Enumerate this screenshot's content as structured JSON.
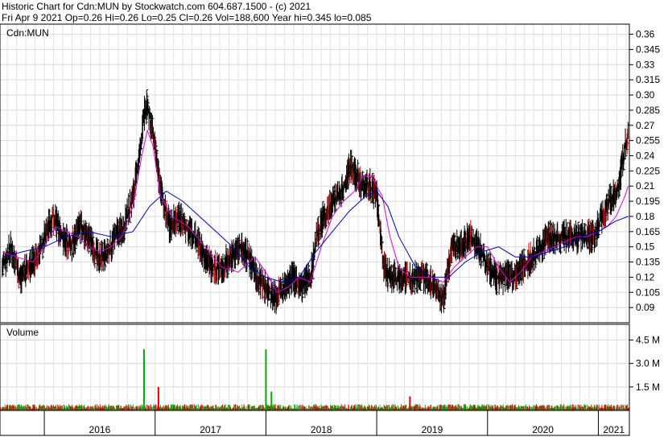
{
  "header": {
    "title": "Historic Chart for Cdn:MUN by Stockwatch.com 604.687.1500 - (c) 2021",
    "summary": "Fri Apr  9 2021  Op=0.26  Hi=0.26  Lo=0.25  Cl=0.26  Vol=188,600  Year hi=0.345  lo=0.085"
  },
  "chart_data": [
    {
      "type": "line",
      "title": "Cdn:MUN",
      "x_type": "year",
      "xlim": [
        2015.6,
        2021.28
      ],
      "ylim": [
        0.075,
        0.37
      ],
      "y_ticks": [
        "0.36",
        "0.345",
        "0.33",
        "0.315",
        "0.30",
        "0.285",
        "0.27",
        "0.255",
        "0.24",
        "0.225",
        "0.21",
        "0.195",
        "0.18",
        "0.165",
        "0.15",
        "0.135",
        "0.12",
        "0.105",
        "0.09"
      ],
      "x_labels": [
        "2016",
        "2017",
        "2018",
        "2019",
        "2020",
        "2021"
      ],
      "grid": true,
      "colors": {
        "price": "#000000",
        "ma_short": "#e000e0",
        "ma_long": "#0000cc"
      },
      "series": [
        {
          "key": "price",
          "x": [
            2015.62,
            2015.7,
            2015.78,
            2015.86,
            2015.94,
            2016.0,
            2016.08,
            2016.16,
            2016.24,
            2016.32,
            2016.4,
            2016.48,
            2016.56,
            2016.64,
            2016.72,
            2016.8,
            2016.86,
            2016.9,
            2016.93,
            2016.98,
            2017.03,
            2017.08,
            2017.13,
            2017.2,
            2017.28,
            2017.36,
            2017.44,
            2017.52,
            2017.6,
            2017.68,
            2017.76,
            2017.84,
            2017.92,
            2018.0,
            2018.08,
            2018.16,
            2018.24,
            2018.32,
            2018.4,
            2018.46,
            2018.52,
            2018.58,
            2018.64,
            2018.7,
            2018.76,
            2018.82,
            2018.88,
            2018.94,
            2019.0,
            2019.06,
            2019.12,
            2019.2,
            2019.28,
            2019.36,
            2019.44,
            2019.52,
            2019.6,
            2019.68,
            2019.76,
            2019.84,
            2019.92,
            2020.0,
            2020.08,
            2020.16,
            2020.24,
            2020.32,
            2020.4,
            2020.48,
            2020.56,
            2020.64,
            2020.72,
            2020.8,
            2020.88,
            2020.96,
            2021.0,
            2021.04,
            2021.08,
            2021.12,
            2021.16,
            2021.2,
            2021.24,
            2021.27
          ],
          "y": [
            0.13,
            0.15,
            0.12,
            0.13,
            0.14,
            0.16,
            0.18,
            0.16,
            0.15,
            0.17,
            0.16,
            0.14,
            0.14,
            0.16,
            0.17,
            0.2,
            0.24,
            0.28,
            0.29,
            0.26,
            0.22,
            0.19,
            0.17,
            0.18,
            0.17,
            0.16,
            0.14,
            0.13,
            0.13,
            0.14,
            0.15,
            0.14,
            0.12,
            0.11,
            0.1,
            0.11,
            0.12,
            0.11,
            0.12,
            0.16,
            0.18,
            0.19,
            0.2,
            0.21,
            0.23,
            0.22,
            0.21,
            0.21,
            0.2,
            0.13,
            0.12,
            0.12,
            0.12,
            0.12,
            0.12,
            0.11,
            0.1,
            0.15,
            0.15,
            0.16,
            0.15,
            0.13,
            0.12,
            0.12,
            0.12,
            0.13,
            0.14,
            0.15,
            0.16,
            0.16,
            0.16,
            0.16,
            0.16,
            0.16,
            0.17,
            0.18,
            0.19,
            0.2,
            0.2,
            0.22,
            0.25,
            0.26
          ]
        },
        {
          "key": "ma_short",
          "x": [
            2015.62,
            2015.75,
            2015.9,
            2016.0,
            2016.1,
            2016.2,
            2016.3,
            2016.4,
            2016.5,
            2016.6,
            2016.7,
            2016.8,
            2016.88,
            2016.93,
            2016.98,
            2017.05,
            2017.15,
            2017.3,
            2017.45,
            2017.6,
            2017.75,
            2017.9,
            2018.0,
            2018.1,
            2018.2,
            2018.3,
            2018.4,
            2018.5,
            2018.6,
            2018.7,
            2018.8,
            2018.88,
            2018.95,
            2019.0,
            2019.05,
            2019.12,
            2019.2,
            2019.3,
            2019.4,
            2019.5,
            2019.6,
            2019.7,
            2019.8,
            2019.9,
            2020.0,
            2020.1,
            2020.2,
            2020.3,
            2020.4,
            2020.5,
            2020.6,
            2020.7,
            2020.8,
            2020.9,
            2021.0,
            2021.08,
            2021.16,
            2021.24,
            2021.27
          ],
          "y": [
            0.145,
            0.14,
            0.135,
            0.15,
            0.17,
            0.165,
            0.16,
            0.15,
            0.145,
            0.15,
            0.16,
            0.19,
            0.24,
            0.265,
            0.25,
            0.2,
            0.18,
            0.17,
            0.15,
            0.13,
            0.125,
            0.14,
            0.125,
            0.105,
            0.11,
            0.12,
            0.115,
            0.15,
            0.18,
            0.195,
            0.205,
            0.22,
            0.22,
            0.21,
            0.2,
            0.16,
            0.13,
            0.12,
            0.12,
            0.12,
            0.115,
            0.13,
            0.14,
            0.15,
            0.15,
            0.13,
            0.115,
            0.125,
            0.14,
            0.145,
            0.15,
            0.155,
            0.16,
            0.16,
            0.165,
            0.17,
            0.18,
            0.2,
            0.21
          ]
        },
        {
          "key": "ma_long",
          "x": [
            2015.62,
            2015.8,
            2016.0,
            2016.2,
            2016.4,
            2016.6,
            2016.8,
            2016.95,
            2017.1,
            2017.25,
            2017.4,
            2017.55,
            2017.7,
            2017.85,
            2018.0,
            2018.15,
            2018.3,
            2018.45,
            2018.6,
            2018.75,
            2018.9,
            2019.0,
            2019.1,
            2019.2,
            2019.35,
            2019.5,
            2019.65,
            2019.8,
            2019.95,
            2020.1,
            2020.25,
            2020.4,
            2020.55,
            2020.7,
            2020.85,
            2021.0,
            2021.15,
            2021.27
          ],
          "y": [
            0.14,
            0.145,
            0.15,
            0.16,
            0.165,
            0.16,
            0.165,
            0.19,
            0.205,
            0.195,
            0.18,
            0.165,
            0.15,
            0.13,
            0.12,
            0.115,
            0.12,
            0.145,
            0.165,
            0.185,
            0.2,
            0.205,
            0.19,
            0.16,
            0.13,
            0.12,
            0.12,
            0.135,
            0.145,
            0.15,
            0.14,
            0.14,
            0.145,
            0.15,
            0.16,
            0.165,
            0.175,
            0.18
          ]
        }
      ]
    },
    {
      "type": "bar",
      "title": "Volume",
      "ylim": [
        0,
        5500000
      ],
      "y_ticks": [
        "4.5 M",
        "3.0 M",
        "1.5 M"
      ],
      "y_tick_values": [
        4500000,
        3000000,
        1500000
      ],
      "colors": {
        "up": "#00aa00",
        "down": "#dd0000",
        "neutral": "#888888"
      },
      "notable_spikes": [
        {
          "x": 2016.9,
          "value": 3900000,
          "direction": "up"
        },
        {
          "x": 2017.03,
          "value": 1500000,
          "direction": "down"
        },
        {
          "x": 2018.0,
          "value": 3900000,
          "direction": "up"
        },
        {
          "x": 2018.05,
          "value": 1200000,
          "direction": "up"
        },
        {
          "x": 2019.3,
          "value": 900000,
          "direction": "down"
        }
      ],
      "typical_volume": 250000
    }
  ]
}
